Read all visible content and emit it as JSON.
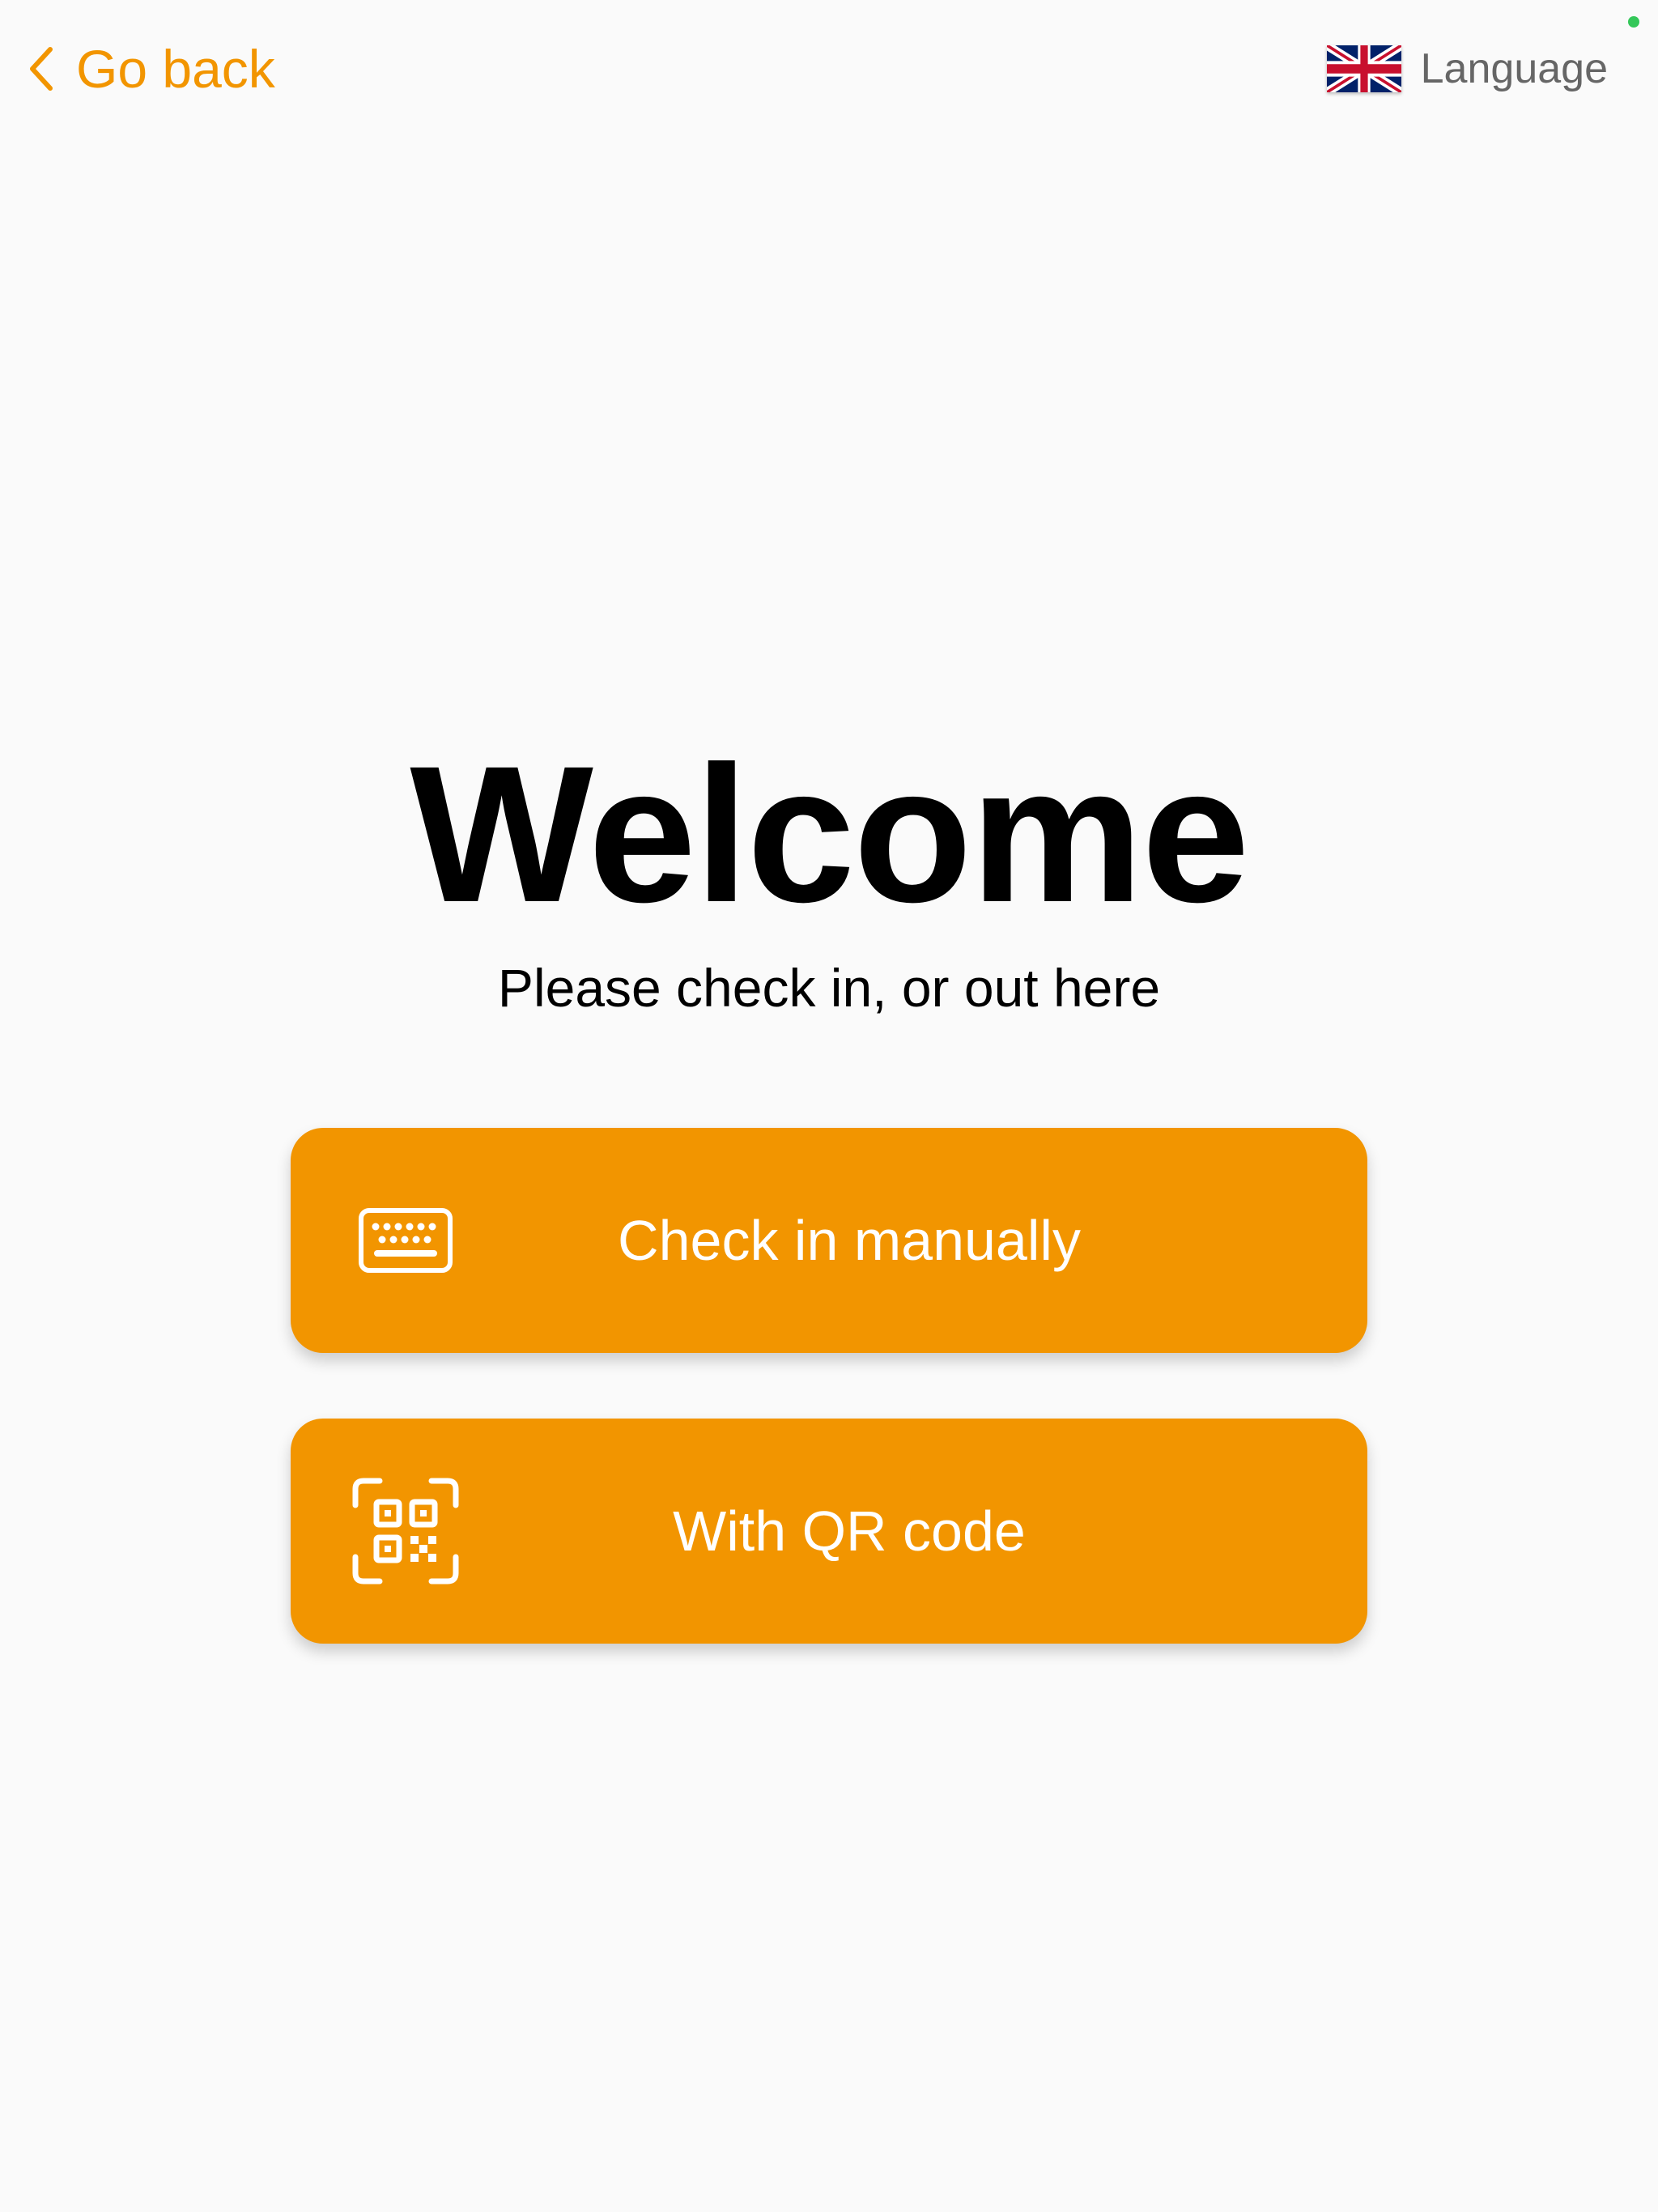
{
  "header": {
    "back_label": "Go back",
    "language_label": "Language"
  },
  "main": {
    "title": "Welcome",
    "subtitle": "Please check in, or out here",
    "buttons": [
      {
        "label": "Check in manually",
        "icon": "keyboard-icon"
      },
      {
        "label": "With QR code",
        "icon": "qr-code-icon"
      }
    ]
  },
  "colors": {
    "accent": "#f29500",
    "background": "#fafafa",
    "text": "#000000",
    "muted_text": "#666666",
    "status_dot": "#34c759"
  }
}
